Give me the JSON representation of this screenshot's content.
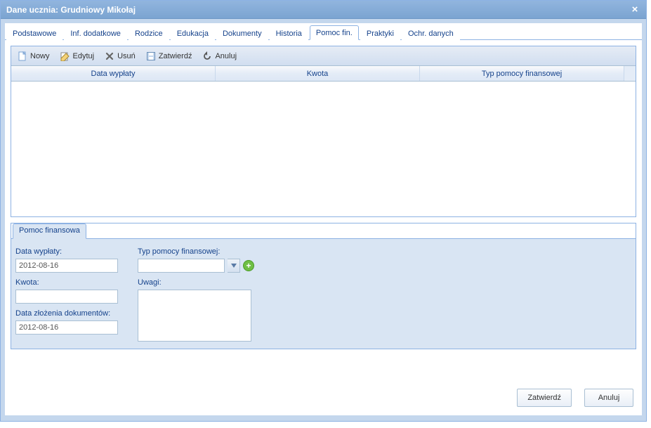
{
  "window_title": "Dane ucznia: Grudniowy Mikołaj",
  "tabs": {
    "podstawowe": "Podstawowe",
    "inf_dodatkowe": "Inf. dodatkowe",
    "rodzice": "Rodzice",
    "edukacja": "Edukacja",
    "dokumenty": "Dokumenty",
    "historia": "Historia",
    "pomoc_fin": "Pomoc fin.",
    "praktyki": "Praktyki",
    "ochr_danych": "Ochr. danych"
  },
  "toolbar": {
    "nowy": "Nowy",
    "edytuj": "Edytuj",
    "usun": "Usuń",
    "zatwierdz": "Zatwierdź",
    "anuluj": "Anuluj"
  },
  "columns": {
    "data_wyplaty": "Data wypłaty",
    "kwota": "Kwota",
    "typ_pomocy": "Typ pomocy finansowej"
  },
  "subtab": {
    "pomoc_finansowa": "Pomoc finansowa"
  },
  "form": {
    "data_wyplaty_label": "Data wypłaty:",
    "data_wyplaty_value": "2012-08-16",
    "kwota_label": "Kwota:",
    "kwota_value": "",
    "data_zlozenia_label": "Data złożenia dokumentów:",
    "data_zlozenia_value": "2012-08-16",
    "typ_label": "Typ pomocy finansowej:",
    "typ_value": "",
    "uwagi_label": "Uwagi:",
    "uwagi_value": ""
  },
  "footer": {
    "zatwierdz": "Zatwierdź",
    "anuluj": "Anuluj"
  },
  "icons": {
    "new": "new-file-icon",
    "edit": "edit-icon",
    "delete": "delete-icon",
    "confirm": "save-icon",
    "cancel": "undo-icon",
    "close": "close-icon",
    "add": "plus-icon",
    "chevron_down": "chevron-down-icon"
  }
}
